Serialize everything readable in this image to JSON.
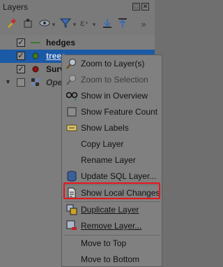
{
  "panel": {
    "title": "Layers",
    "title_buttons": [
      "□",
      "✕"
    ],
    "toolbar": {
      "overflow": "»"
    },
    "layers": [
      {
        "name": "hedges",
        "checked": true,
        "symbol": "line"
      },
      {
        "name": "trees",
        "checked": true,
        "symbol": "point",
        "selected": true
      },
      {
        "name": "Surv",
        "checked": true,
        "symbol": "red-point"
      },
      {
        "name": "Ope",
        "checked": false,
        "symbol": "raster"
      }
    ]
  },
  "menu": {
    "items": [
      {
        "label": "Zoom to Layer(s)",
        "icon": "zoom-icon",
        "enabled": true
      },
      {
        "label": "Zoom to Selection",
        "icon": "zoom-selection-icon",
        "enabled": false
      },
      {
        "label": "Show in Overview",
        "icon": "overview-glasses-icon",
        "enabled": true
      },
      {
        "label": "Show Feature Count",
        "icon": "checkbox-icon",
        "enabled": true
      },
      {
        "label": "Show Labels",
        "icon": "labels-icon",
        "enabled": true
      },
      {
        "label": "Copy Layer",
        "icon": "",
        "enabled": true
      },
      {
        "label": "Rename Layer",
        "icon": "",
        "enabled": true
      },
      {
        "label": "Update SQL Layer...",
        "icon": "database-icon",
        "enabled": true
      },
      {
        "label": "Show Local Changes",
        "icon": "document-icon",
        "enabled": true,
        "highlighted": true
      },
      {
        "label": "Duplicate Layer",
        "icon": "duplicate-icon",
        "enabled": true
      },
      {
        "label": "Remove Layer...",
        "icon": "remove-layer-icon",
        "enabled": true
      },
      {
        "label": "Move to Top",
        "icon": "",
        "enabled": true
      },
      {
        "label": "Move to Bottom",
        "icon": "",
        "enabled": true
      }
    ],
    "highlight_color": "#e8141b"
  }
}
